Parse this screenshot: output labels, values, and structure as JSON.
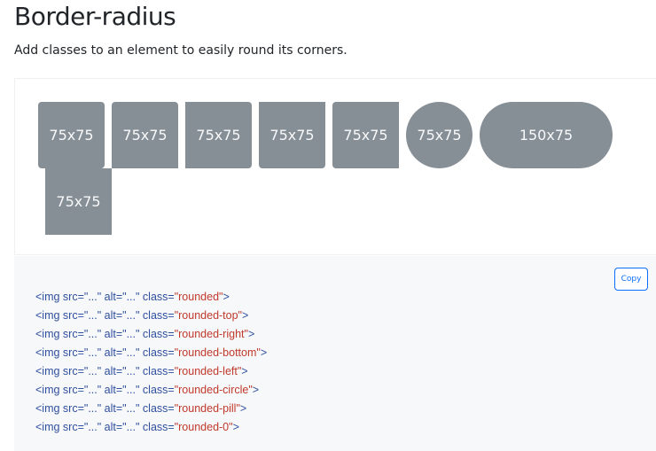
{
  "heading": {
    "title": "Border-radius",
    "lead": "Add classes to an element to easily round its corners."
  },
  "example": {
    "placeholders": [
      {
        "label": "75x75",
        "variant": "rounded"
      },
      {
        "label": "75x75",
        "variant": "rounded-top"
      },
      {
        "label": "75x75",
        "variant": "rounded-right"
      },
      {
        "label": "75x75",
        "variant": "rounded-bottom"
      },
      {
        "label": "75x75",
        "variant": "rounded-left"
      },
      {
        "label": "75x75",
        "variant": "rounded-circle"
      },
      {
        "label": "150x75",
        "variant": "rounded-pill"
      },
      {
        "label": "75x75",
        "variant": "rounded-0"
      }
    ]
  },
  "code": {
    "copy_label": "Copy",
    "lines": [
      {
        "prefix": "<img src=\"...\" alt=\"...\" class=",
        "cls": "\"rounded\"",
        "suffix": ">"
      },
      {
        "prefix": "<img src=\"...\" alt=\"...\" class=",
        "cls": "\"rounded-top\"",
        "suffix": ">"
      },
      {
        "prefix": "<img src=\"...\" alt=\"...\" class=",
        "cls": "\"rounded-right\"",
        "suffix": ">"
      },
      {
        "prefix": "<img src=\"...\" alt=\"...\" class=",
        "cls": "\"rounded-bottom\"",
        "suffix": ">"
      },
      {
        "prefix": "<img src=\"...\" alt=\"...\" class=",
        "cls": "\"rounded-left\"",
        "suffix": ">"
      },
      {
        "prefix": "<img src=\"...\" alt=\"...\" class=",
        "cls": "\"rounded-circle\"",
        "suffix": ">"
      },
      {
        "prefix": "<img src=\"...\" alt=\"...\" class=",
        "cls": "\"rounded-pill\"",
        "suffix": ">"
      },
      {
        "prefix": "<img src=\"...\" alt=\"...\" class=",
        "cls": "\"rounded-0\"",
        "suffix": ">"
      }
    ]
  },
  "colors": {
    "placeholder_bg": "#868e96",
    "placeholder_text": "#f8f9fa",
    "accent": "#0d6efd",
    "code_tag": "#2f4f9f",
    "code_string": "#c0392b"
  }
}
